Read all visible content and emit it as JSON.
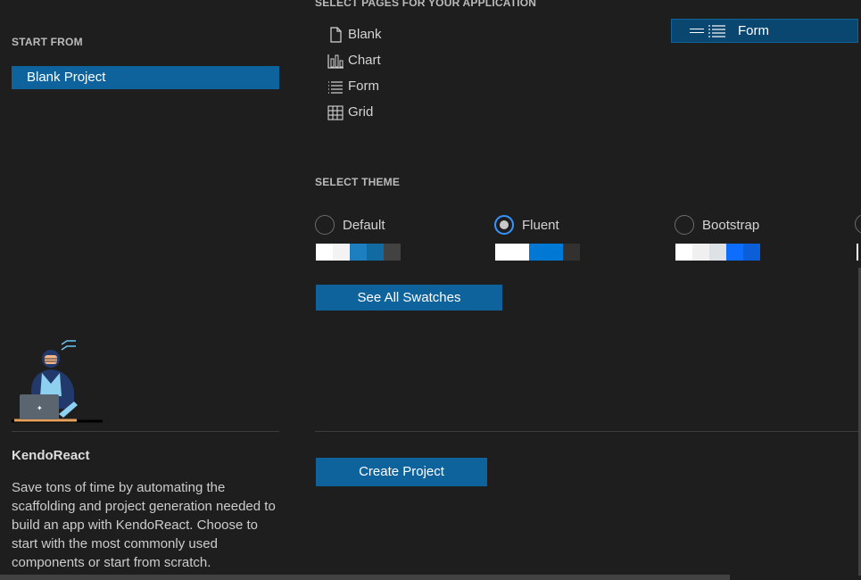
{
  "left": {
    "start_from_title": "START FROM",
    "project_item": "Blank Project",
    "product_title": "KendoReact",
    "description": "Save tons of time by automating the scaffolding and project generation needed to build an app with KendoReact. Choose to start with the most commonly used components or start from scratch."
  },
  "pages": {
    "title": "SELECT PAGES FOR YOUR APPLICATION",
    "items": [
      {
        "label": "Blank",
        "icon": "file-icon"
      },
      {
        "label": "Chart",
        "icon": "bar-chart-icon"
      },
      {
        "label": "Form",
        "icon": "list-icon"
      },
      {
        "label": "Grid",
        "icon": "table-icon"
      }
    ],
    "selected": [
      {
        "label": "Form",
        "icon": "list-icon"
      }
    ]
  },
  "theme": {
    "title": "SELECT THEME",
    "options": [
      {
        "label": "Default",
        "checked": false,
        "swatch": [
          "#ffffff",
          "#f3f3f3",
          "#1e7fc0",
          "#126ba0",
          "#424242"
        ]
      },
      {
        "label": "Fluent",
        "checked": true,
        "swatch": [
          "#ffffff",
          "#ffffff",
          "#0078d4",
          "#0078d4",
          "#323130"
        ]
      },
      {
        "label": "Bootstrap",
        "checked": false,
        "swatch": [
          "#ffffff",
          "#f0f0f0",
          "#dee2e6",
          "#0d6efd",
          "#0b5ed7"
        ]
      }
    ],
    "see_all_label": "See All Swatches"
  },
  "actions": {
    "create_label": "Create Project"
  },
  "colors": {
    "background": "#1e1e1e",
    "accent": "#0e639c",
    "selected_bg": "#094771"
  }
}
